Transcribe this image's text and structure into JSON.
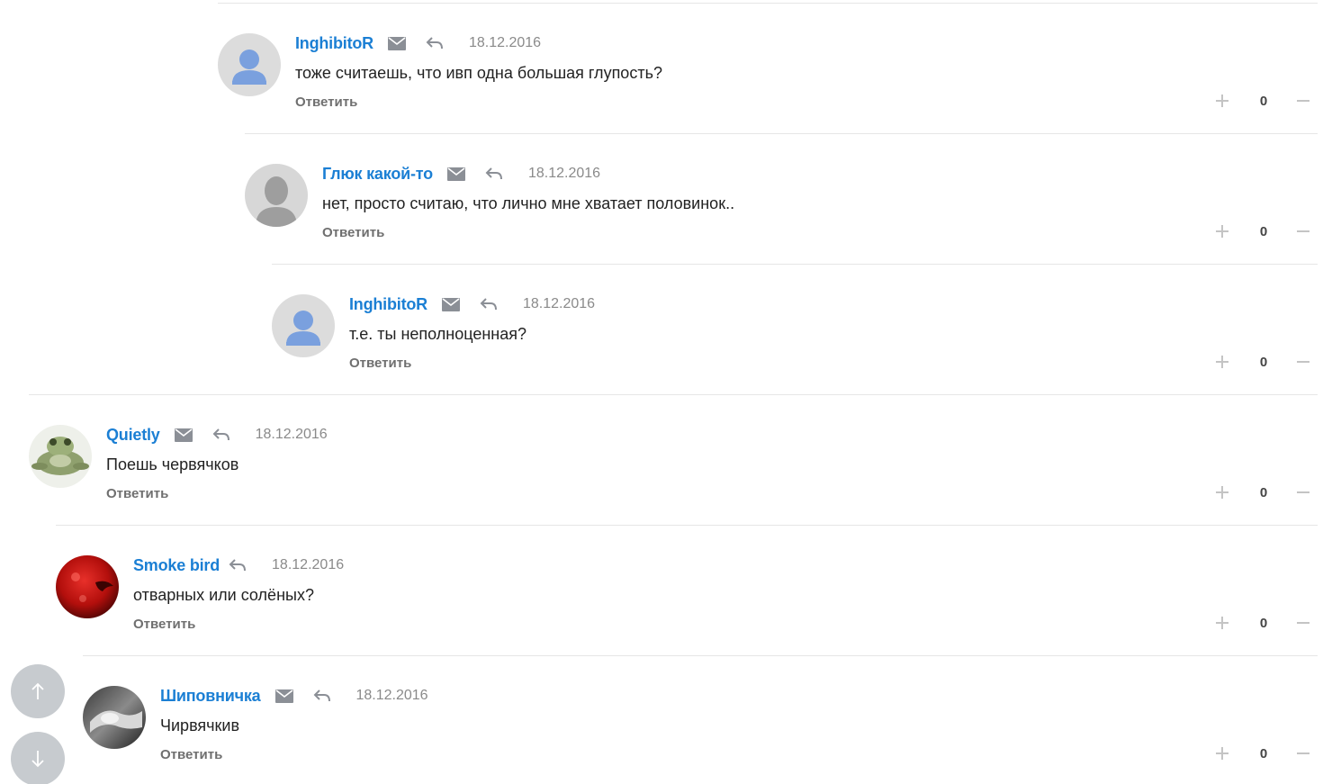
{
  "reply_label": "Ответить",
  "comments": [
    {
      "author": "InghibitoR",
      "date": "18.12.2016",
      "text": "тоже считаешь, что ивп одна большая глупость?",
      "score": "0",
      "avatar": "default-blue-user-avatar",
      "has_mail": true
    },
    {
      "author": "Глюк какой-то",
      "date": "18.12.2016",
      "text": "нет, просто считаю, что лично мне хватает половинок..",
      "score": "0",
      "avatar": "default-gray-user-avatar",
      "has_mail": true
    },
    {
      "author": "InghibitoR",
      "date": "18.12.2016",
      "text": "т.е. ты неполноценная?",
      "score": "0",
      "avatar": "default-blue-user-avatar",
      "has_mail": true
    },
    {
      "author": "Quietly",
      "date": "18.12.2016",
      "text": "Поешь червячков",
      "score": "0",
      "avatar": "frog-photo-avatar",
      "has_mail": true
    },
    {
      "author": "Smoke bird",
      "date": "18.12.2016",
      "text": "отварных или солёных?",
      "score": "0",
      "avatar": "red-bird-photo-avatar",
      "has_mail": false
    },
    {
      "author": "Шиповничка",
      "date": "18.12.2016",
      "text": "Чирвячкив",
      "score": "0",
      "avatar": "grayscale-photo-avatar",
      "has_mail": true
    }
  ],
  "icons": {
    "mail": "mail-icon",
    "reply": "reply-arrow-icon",
    "plus": "plus-icon",
    "minus": "minus-icon",
    "scroll_up": "arrow-up-icon",
    "scroll_down": "arrow-down-icon"
  },
  "colors": {
    "author": "#1b7fd4",
    "date": "#8a8a8a",
    "reply_link": "#6f6f6f",
    "scroll_button": "#c7cbcf",
    "separator": "#e6e6e6"
  }
}
